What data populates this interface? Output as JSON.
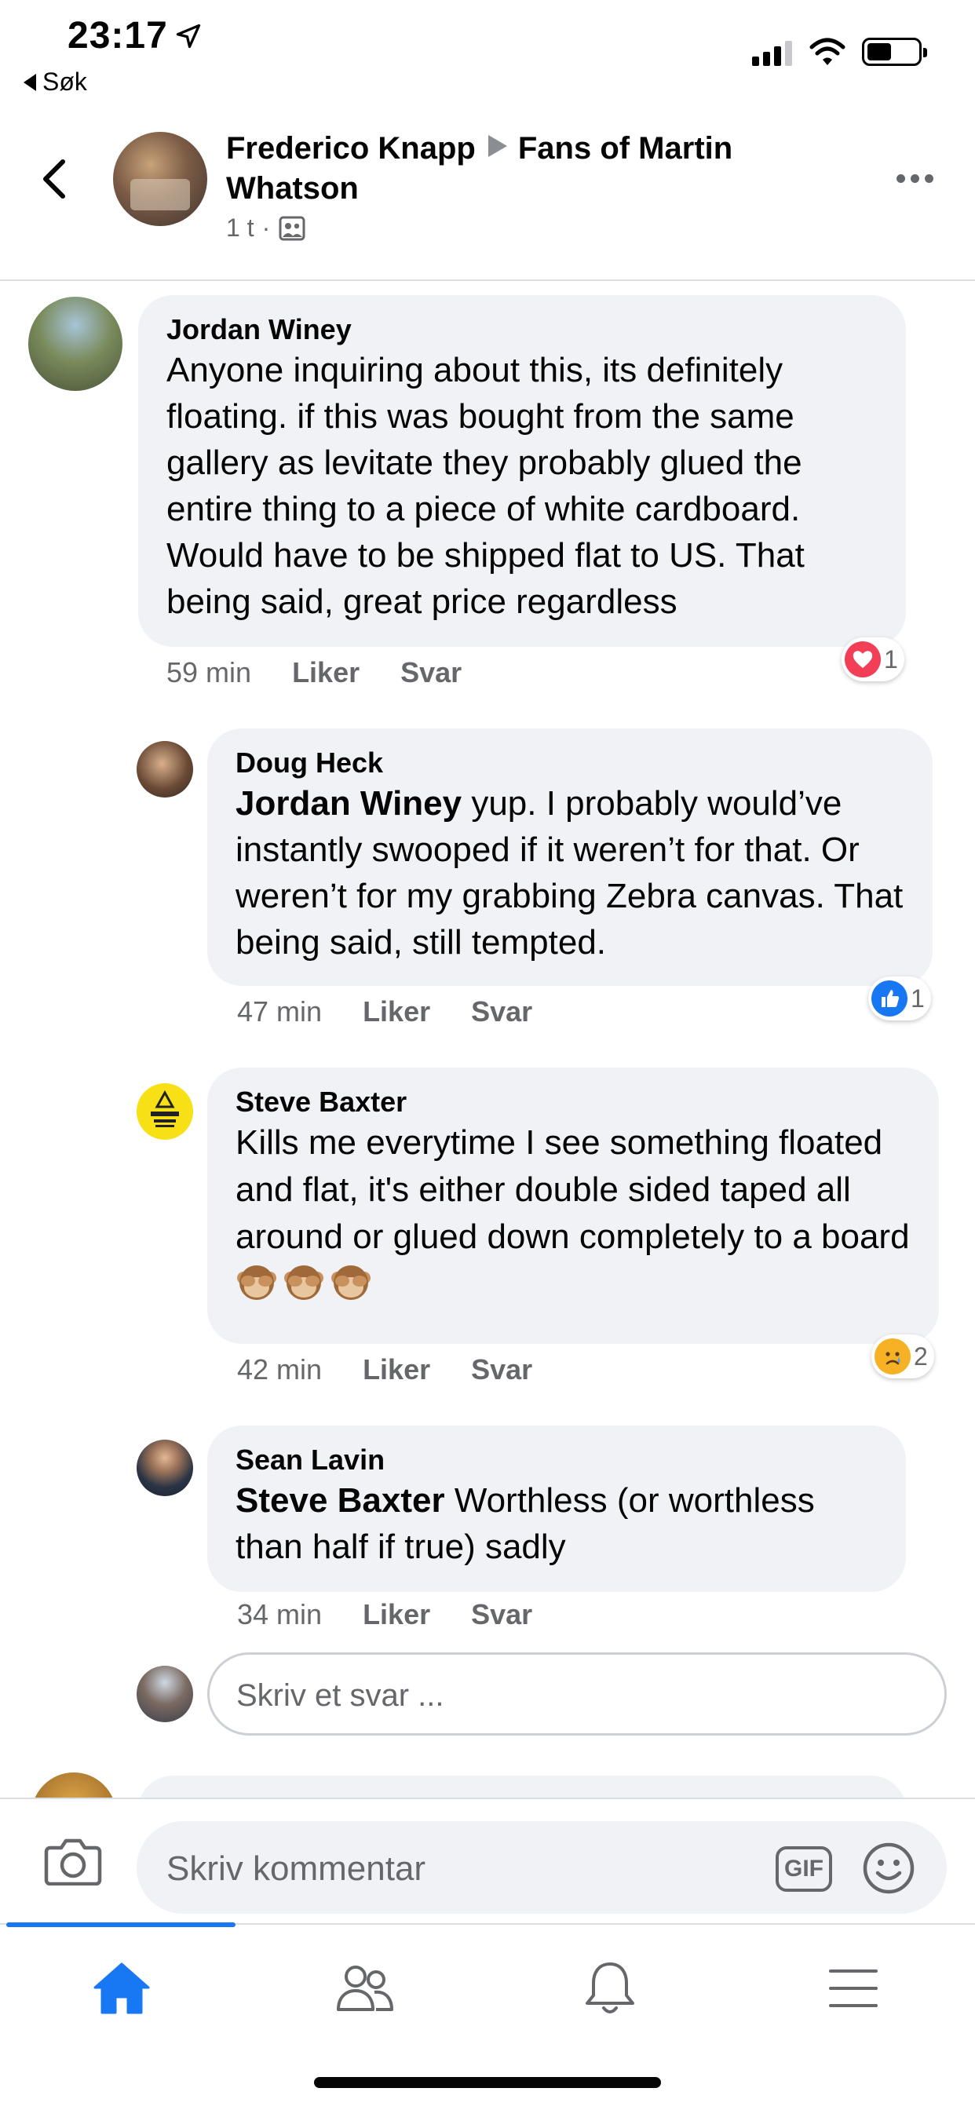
{
  "status_bar": {
    "time": "23:17",
    "back_app_label": "Søk",
    "icons": [
      "location-arrow-icon",
      "cellular-signal-icon",
      "wifi-icon",
      "battery-icon"
    ]
  },
  "post_header": {
    "author": "Frederico Knapp",
    "group": "Fans of Martin Whatson",
    "time": "1 t",
    "separator": "·",
    "icons": [
      "back-chevron-icon",
      "group-audience-icon",
      "more-options-icon"
    ]
  },
  "comments": [
    {
      "name": "Jordan Winey",
      "mention": "",
      "text": "Anyone inquiring about this, its definitely floating. if this was bought from the same gallery as levitate they probably glued the entire thing to a piece of white cardboard. Would have to be shipped flat to US. That being said, great price regardless",
      "time": "59 min",
      "like_label": "Liker",
      "reply_label": "Svar",
      "reaction_type": "love",
      "reaction_count": "1"
    },
    {
      "name": "Doug Heck",
      "mention": "Jordan Winey",
      "text": " yup. I probably would’ve instantly swooped if it weren’t for that. Or weren’t for my grabbing Zebra canvas. That being said, still tempted.",
      "time": "47 min",
      "like_label": "Liker",
      "reply_label": "Svar",
      "reaction_type": "like",
      "reaction_count": "1"
    },
    {
      "name": "Steve Baxter",
      "mention": "",
      "text": "Kills me everytime I see something floated and flat,  it's either double sided taped all around or glued down completely to a board ",
      "emoji": [
        "see-no-evil-monkey-emoji",
        "see-no-evil-monkey-emoji",
        "see-no-evil-monkey-emoji"
      ],
      "time": "42 min",
      "like_label": "Liker",
      "reply_label": "Svar",
      "reaction_type": "sad",
      "reaction_count": "2"
    },
    {
      "name": "Sean Lavin",
      "mention": "Steve Baxter",
      "text": " Worthless (or worthless than half if true) sadly",
      "time": "34 min",
      "like_label": "Liker",
      "reply_label": "Svar"
    }
  ],
  "reply_input": {
    "placeholder": "Skriv et svar ..."
  },
  "composer": {
    "placeholder": "Skriv kommentar",
    "gif_label": "GIF",
    "icons": [
      "camera-icon",
      "gif-icon",
      "emoji-smiley-icon"
    ]
  },
  "tabbar": {
    "tabs": [
      "home-icon",
      "friends-icon",
      "notifications-bell-icon",
      "menu-icon"
    ],
    "active": "home-icon"
  },
  "colors": {
    "accent": "#1877f2",
    "bubble": "#f0f2f5",
    "secondary_text": "#65676b",
    "love": "#f33e58",
    "sad": "#f7b125"
  }
}
